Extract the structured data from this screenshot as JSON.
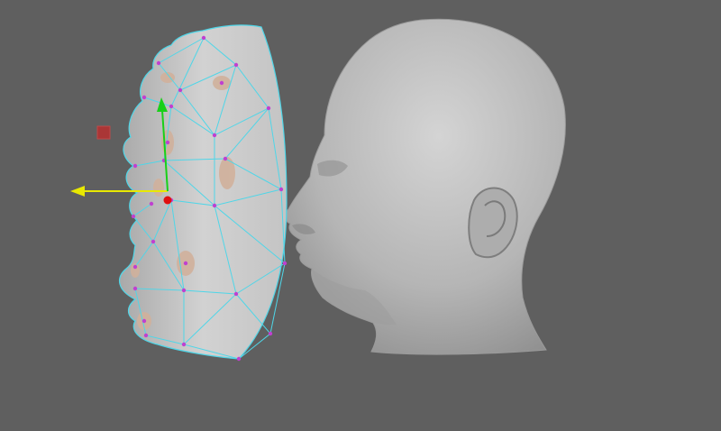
{
  "viewport": {
    "background": "#5f5f5f",
    "objects": [
      {
        "name": "deformed-mask-mesh",
        "wireframe_color": "#4fd6e8",
        "vertex_color": "#c040d0",
        "surface_color": "#cfcfcf"
      },
      {
        "name": "head-model",
        "surface_color": "#b8b8b8"
      }
    ],
    "manipulator": {
      "x_axis_color": "#e8e800",
      "y_axis_color": "#18d018",
      "z_axis_color": "#e01010",
      "scale_handle_color": "#b83030"
    }
  }
}
